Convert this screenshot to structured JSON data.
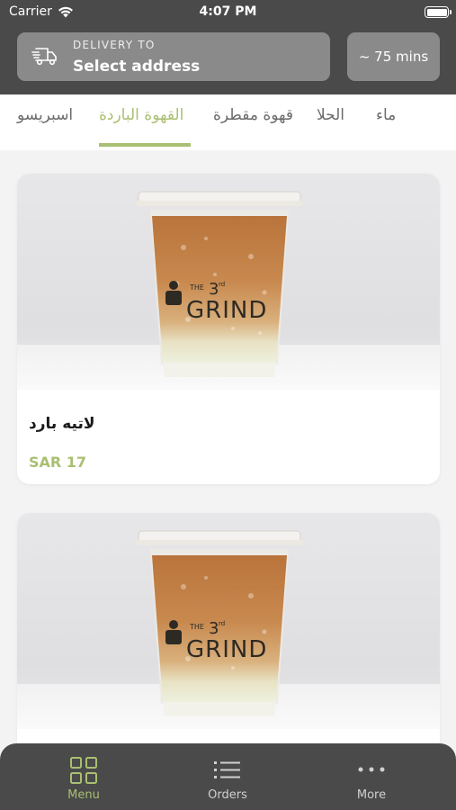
{
  "status_bar": {
    "carrier": "Carrier",
    "time": "4:07 PM",
    "icons": [
      "wifi-icon",
      "battery-icon"
    ]
  },
  "header": {
    "delivery_label": "DELIVERY TO",
    "delivery_address": "Select address",
    "delivery_icon": "delivery-truck-icon",
    "eta": "~ 75 mins"
  },
  "categories": {
    "items": [
      "ماء",
      "الحلا",
      "قهوة مقطرة",
      "القهوة الباردة",
      "اسبريسو"
    ],
    "selected": "القهوة الباردة"
  },
  "products": [
    {
      "name": "لاتيه بارد",
      "price": "SAR 17",
      "brand": "THE 3rd GRIND"
    },
    {
      "name": "",
      "price": "",
      "brand": "THE 3rd GRIND"
    }
  ],
  "tab_bar": {
    "items": [
      {
        "label": "Menu",
        "icon": "grid-icon"
      },
      {
        "label": "Orders",
        "icon": "list-icon"
      },
      {
        "label": "More",
        "icon": "more-dots-icon"
      }
    ],
    "selected": "Menu"
  },
  "colors": {
    "accent": "#a9bf72",
    "header_bg": "#4a4a4a",
    "chip_bg": "#8a8a8a",
    "page_bg": "#f3f3f3"
  }
}
